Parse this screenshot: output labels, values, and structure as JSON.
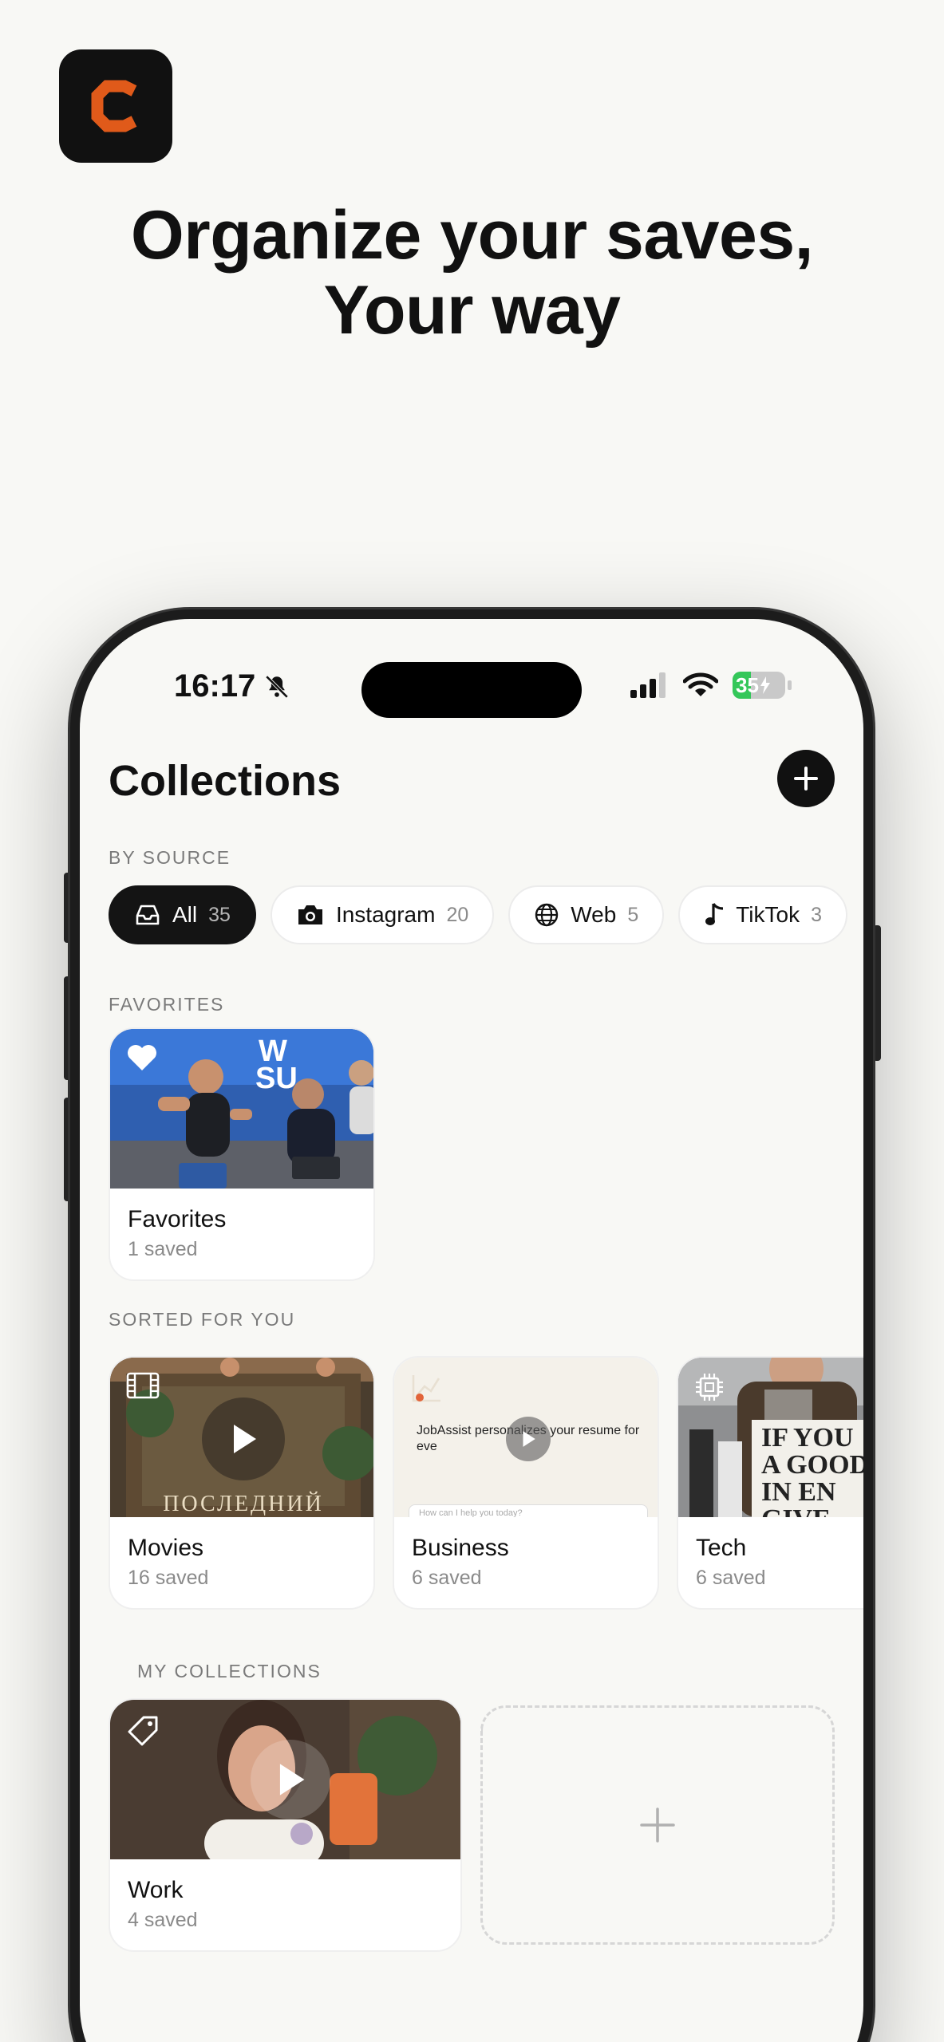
{
  "hero": {
    "headline_line1": "Organize your saves,",
    "headline_line2": "Your way",
    "logo_letter": "C",
    "logo_accent": "#e05a1a"
  },
  "status_bar": {
    "time": "16:17",
    "battery": "35",
    "battery_level": 0.35,
    "icons": [
      "bell-slash-icon",
      "cellular-icon",
      "wifi-icon",
      "battery-icon"
    ]
  },
  "header": {
    "title": "Collections",
    "add_icon": "plus-icon"
  },
  "by_source": {
    "label": "BY SOURCE",
    "chips": [
      {
        "label": "All",
        "count": "35",
        "icon": "tray-icon",
        "active": true
      },
      {
        "label": "Instagram",
        "count": "20",
        "icon": "camera-icon",
        "active": false
      },
      {
        "label": "Web",
        "count": "5",
        "icon": "globe-icon",
        "active": false
      },
      {
        "label": "TikTok",
        "count": "3",
        "icon": "music-note-icon",
        "active": false
      }
    ]
  },
  "favorites": {
    "label": "FAVORITES",
    "card": {
      "title": "Favorites",
      "subtitle": "1 saved",
      "icon": "heart-icon"
    }
  },
  "sorted": {
    "label": "SORTED FOR YOU",
    "cards": [
      {
        "title": "Movies",
        "subtitle": "16 saved",
        "icon": "film-icon",
        "thumb_text": "ПОСЛЕДНИЙ"
      },
      {
        "title": "Business",
        "subtitle": "6 saved",
        "icon": "chart-icon",
        "thumb_text": "JobAssist personalizes your resume for eve",
        "thumb_input": "How can I help you today?"
      },
      {
        "title": "Tech",
        "subtitle": "6 saved",
        "icon": "chip-icon",
        "thumb_text": "IF YOU A GOOD IN EN GIVE ME A"
      }
    ]
  },
  "my_collections": {
    "label": "MY COLLECTIONS",
    "cards": [
      {
        "title": "Work",
        "subtitle": "4 saved",
        "icon": "tag-icon"
      }
    ],
    "new_icon": "plus-icon"
  }
}
